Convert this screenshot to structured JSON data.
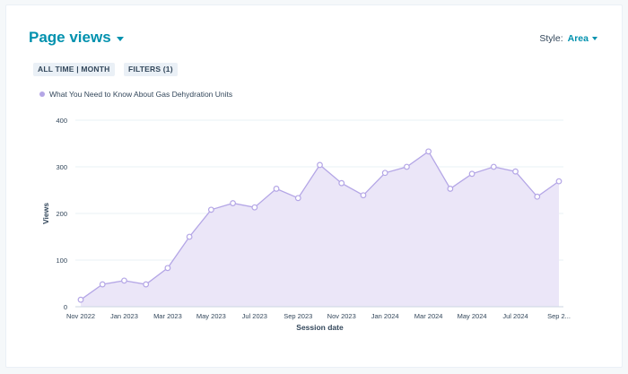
{
  "header": {
    "title": "Page views",
    "style_label": "Style:",
    "style_value": "Area"
  },
  "filters": {
    "time_chip": "ALL TIME | MONTH",
    "filters_chip": "FILTERS (1)"
  },
  "colors": {
    "accent": "#0091ae",
    "series_line": "#b4a6e6",
    "series_fill": "#ebe6f8"
  },
  "chart_data": {
    "type": "area",
    "xlabel": "Session date",
    "ylabel": "Views",
    "ylim": [
      0,
      400
    ],
    "yticks": [
      0,
      100,
      200,
      300,
      400
    ],
    "grid": true,
    "legend_position": "top-left",
    "x": [
      "Nov 2022",
      "Dec 2022",
      "Jan 2023",
      "Feb 2023",
      "Mar 2023",
      "Apr 2023",
      "May 2023",
      "Jun 2023",
      "Jul 2023",
      "Aug 2023",
      "Sep 2023",
      "Oct 2023",
      "Nov 2023",
      "Dec 2023",
      "Jan 2024",
      "Feb 2024",
      "Mar 2024",
      "Apr 2024",
      "May 2024",
      "Jun 2024",
      "Jul 2024",
      "Aug 2024",
      "Sep 2024"
    ],
    "xtick_labels": [
      "Nov 2022",
      "Jan 2023",
      "Mar 2023",
      "May 2023",
      "Jul 2023",
      "Sep 2023",
      "Nov 2023",
      "Jan 2024",
      "Mar 2024",
      "May 2024",
      "Jul 2024",
      "Sep 2..."
    ],
    "series": [
      {
        "name": "What You Need to Know About Gas Dehydration Units",
        "values": [
          15,
          48,
          56,
          48,
          83,
          150,
          208,
          222,
          213,
          253,
          233,
          304,
          265,
          239,
          287,
          300,
          333,
          253,
          285,
          300,
          290,
          236,
          269
        ]
      }
    ]
  }
}
